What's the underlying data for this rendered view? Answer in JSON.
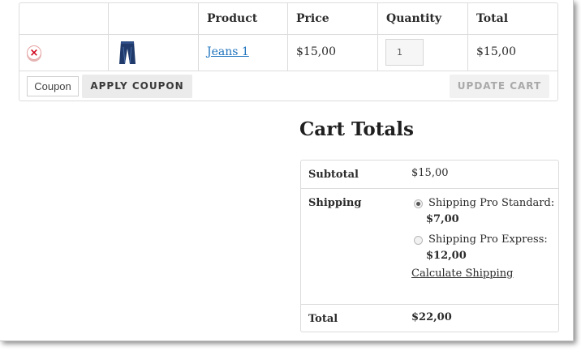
{
  "cart": {
    "headers": {
      "product": "Product",
      "price": "Price",
      "quantity": "Quantity",
      "total": "Total"
    },
    "rows": [
      {
        "product": "Jeans 1",
        "price": "$15,00",
        "quantity": "1",
        "total": "$15,00"
      }
    ],
    "remove_icon": "×",
    "coupon_label": "Coupon",
    "apply_coupon_label": "APPLY COUPON",
    "update_cart_label": "UPDATE CART"
  },
  "totals": {
    "title": "Cart Totals",
    "subtotal_label": "Subtotal",
    "subtotal_value": "$15,00",
    "shipping_label": "Shipping",
    "shipping_options": [
      {
        "name": "Shipping Pro Standard:",
        "price": "$7,00",
        "selected": true
      },
      {
        "name": "Shipping Pro Express:",
        "price": "$12,00",
        "selected": false
      }
    ],
    "calculate_shipping": "Calculate Shipping",
    "total_label": "Total",
    "total_value": "$22,00"
  },
  "colors": {
    "link": "#1e73be",
    "remove": "#d0021b",
    "border": "#dcdcdc"
  },
  "icons": {
    "remove": "remove-icon",
    "product_thumb": "jeans-thumbnail-icon"
  }
}
